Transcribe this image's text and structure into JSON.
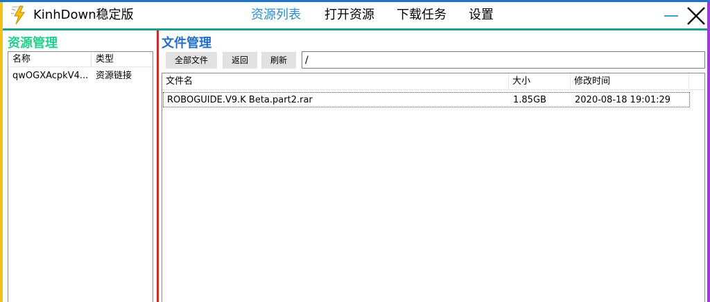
{
  "app": {
    "title": "KinhDown稳定版",
    "icon": "lightning-bolt-icon"
  },
  "nav": {
    "items": [
      {
        "label": "资源列表",
        "active": true
      },
      {
        "label": "打开资源",
        "active": false
      },
      {
        "label": "下载任务",
        "active": false
      },
      {
        "label": "设置",
        "active": false
      }
    ]
  },
  "window_controls": {
    "minimize": "minimize-icon",
    "close": "close-icon"
  },
  "resource_panel": {
    "title": "资源管理",
    "columns": [
      "名称",
      "类型"
    ],
    "rows": [
      {
        "name": "qwOGXAcpkV4...",
        "type": "资源链接"
      }
    ]
  },
  "file_panel": {
    "title": "文件管理",
    "buttons": {
      "all_files": "全部文件",
      "back": "返回",
      "refresh": "刷新"
    },
    "path": "/",
    "columns": [
      "文件名",
      "大小",
      "修改时间"
    ],
    "rows": [
      {
        "name": "ROBOGUIDE.V9.K Beta.part2.rar",
        "size": "1.85GB",
        "modified": "2020-08-18 19:01:29"
      }
    ]
  },
  "colors": {
    "top_border": "#1f73c8",
    "left_border": "#f2c21b",
    "right_border": "#9b3cd6",
    "teal_line": "#1e9e8c",
    "red_divider": "#d32b2b",
    "active_nav": "#2a8fd6",
    "resource_title": "#1fd08a",
    "file_title": "#1f6fc8"
  }
}
